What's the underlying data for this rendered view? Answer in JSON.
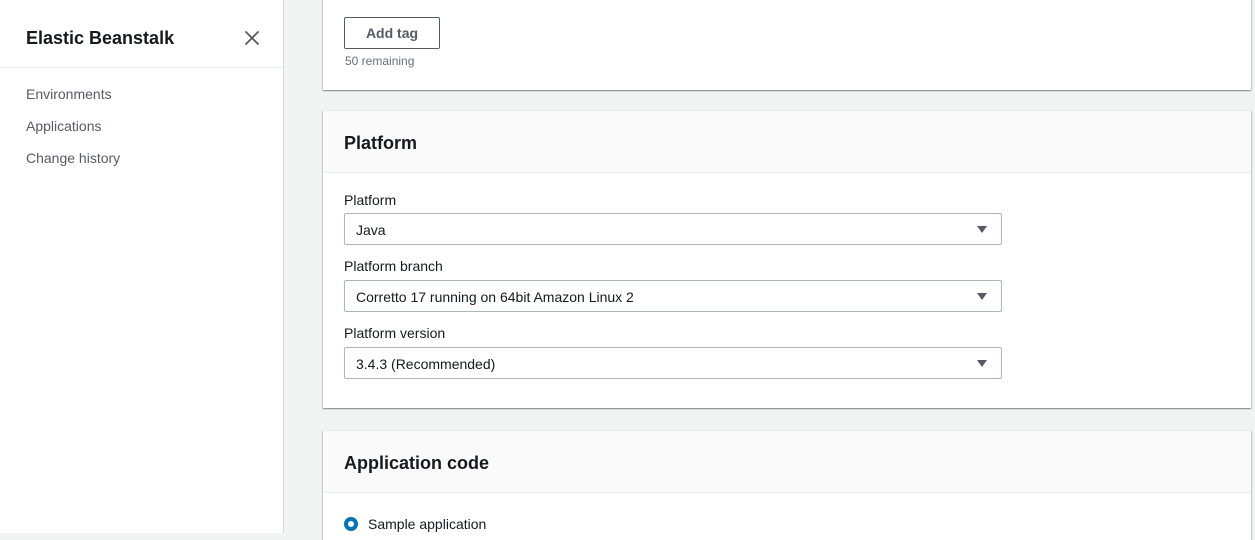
{
  "sidebar": {
    "title": "Elastic Beanstalk",
    "close_icon": "close-icon",
    "items": [
      {
        "label": "Environments"
      },
      {
        "label": "Applications"
      },
      {
        "label": "Change history"
      }
    ]
  },
  "tags": {
    "add_button_label": "Add tag",
    "remaining_text": "50 remaining"
  },
  "platform": {
    "section_title": "Platform",
    "platform_label": "Platform",
    "platform_value": "Java",
    "branch_label": "Platform branch",
    "branch_value": "Corretto 17 running on 64bit Amazon Linux 2",
    "version_label": "Platform version",
    "version_value": "3.4.3 (Recommended)"
  },
  "application_code": {
    "section_title": "Application code",
    "option_sample": "Sample application",
    "selected": "Sample application"
  },
  "colors": {
    "accent": "#0073bb",
    "background": "#f2f3f3",
    "text": "#16191f"
  }
}
